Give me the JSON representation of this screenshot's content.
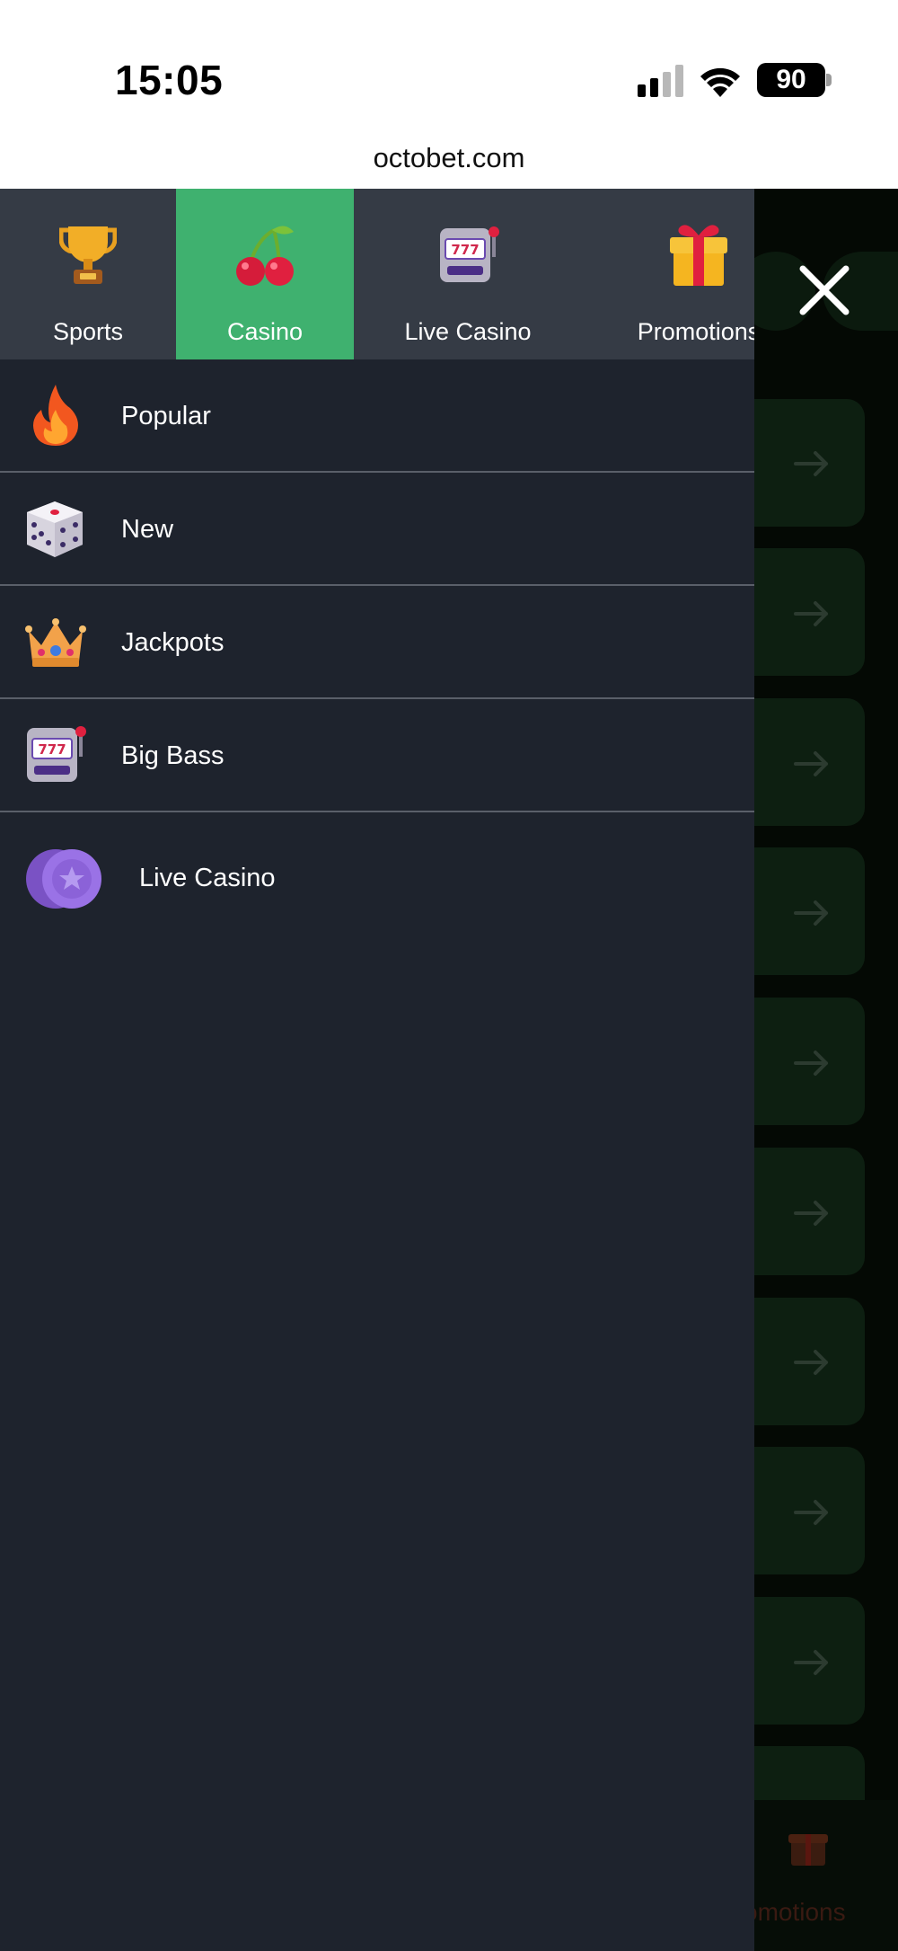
{
  "status_bar": {
    "time": "15:05",
    "battery": "90"
  },
  "browser": {
    "url": "octobet.com"
  },
  "drawer": {
    "tabs": [
      {
        "label": "Sports",
        "icon": "trophy-icon"
      },
      {
        "label": "Casino",
        "icon": "cherry-icon",
        "active": true
      },
      {
        "label": "Live Casino",
        "icon": "slot-machine-icon"
      },
      {
        "label": "Promotions",
        "icon": "gift-icon"
      }
    ],
    "menu": [
      {
        "label": "Popular",
        "icon": "fire-icon"
      },
      {
        "label": "New",
        "icon": "dice-icon"
      },
      {
        "label": "Jackpots",
        "icon": "crown-icon"
      },
      {
        "label": "Big Bass",
        "icon": "slot-machine-icon"
      },
      {
        "label": "Live Casino",
        "icon": "coin-icon"
      }
    ]
  },
  "background": {
    "promotions_label": "Promotions"
  },
  "colors": {
    "active_tab": "#3fb16f",
    "tab_bar": "#353b45",
    "drawer_bg": "#1e232d",
    "overlay_bg": "#040904"
  }
}
